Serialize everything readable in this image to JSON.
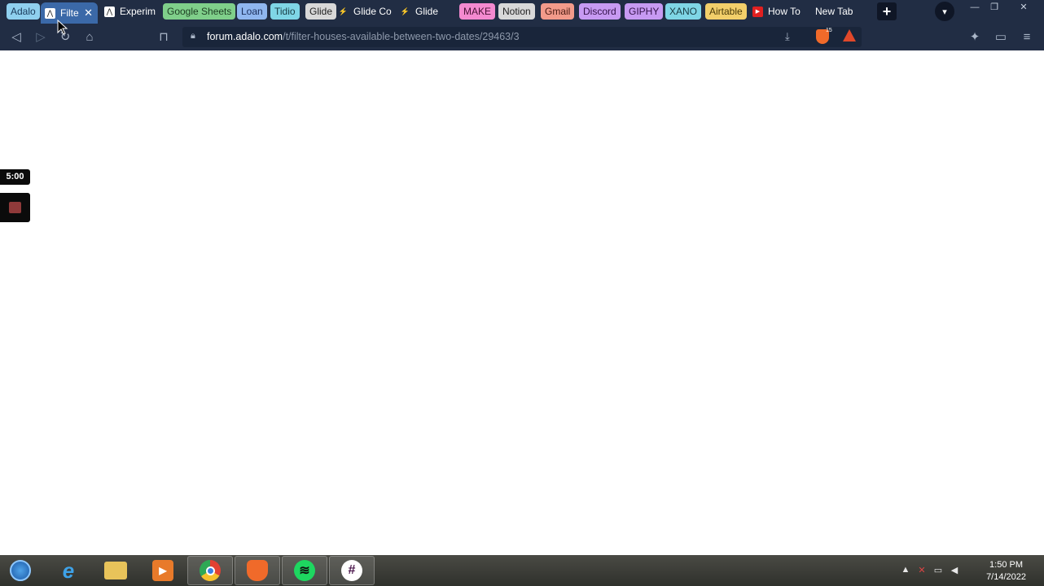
{
  "browser": {
    "tabs": [
      {
        "label": "Adalo",
        "type": "group",
        "color": "#8fd0ef",
        "text_color": "#1a3a5a"
      },
      {
        "label": "Filte",
        "type": "tab",
        "active": true,
        "icon": "adalo-icon"
      },
      {
        "label": "Experim",
        "type": "tab",
        "icon": "adalo-icon"
      },
      {
        "label": "Google Sheets",
        "type": "group",
        "color": "#7fcf8a",
        "text_color": "#1d3d22"
      },
      {
        "label": "Loan",
        "type": "group",
        "color": "#8fb6ef",
        "text_color": "#1a2d5a"
      },
      {
        "label": "Tidio",
        "type": "group",
        "color": "#7fd6e6",
        "text_color": "#1a3d45"
      },
      {
        "label": "Glide",
        "type": "group",
        "color": "#d8d8d8",
        "text_color": "#222222"
      },
      {
        "label": "Glide Co",
        "type": "tab",
        "icon": "glide-icon"
      },
      {
        "label": "Glide",
        "type": "tab",
        "icon": "glide-icon"
      },
      {
        "label": "MAKE",
        "type": "group",
        "color": "#f48ad0",
        "text_color": "#4a1236"
      },
      {
        "label": "Notion",
        "type": "group",
        "color": "#d8d8d8",
        "text_color": "#222222"
      },
      {
        "label": "Gmail",
        "type": "group",
        "color": "#f29a8a",
        "text_color": "#4a1a12"
      },
      {
        "label": "Discord",
        "type": "group",
        "color": "#c79af2",
        "text_color": "#34124a"
      },
      {
        "label": "GIPHY",
        "type": "group",
        "color": "#c79af2",
        "text_color": "#34124a"
      },
      {
        "label": "XANO",
        "type": "group",
        "color": "#7fd6e6",
        "text_color": "#1a3d45"
      },
      {
        "label": "Airtable",
        "type": "group",
        "color": "#f2cf6a",
        "text_color": "#4a3a08"
      },
      {
        "label": "How To",
        "type": "tab",
        "icon": "youtube-icon"
      },
      {
        "label": "New Tab",
        "type": "tab",
        "icon": ""
      }
    ],
    "url_host": "forum.adalo.com",
    "url_path": "/t/filter-houses-available-between-two-dates/29463/3",
    "brave_badge": "15"
  },
  "recorder": {
    "timer": "5:00"
  },
  "taskbar": {
    "apps": [
      {
        "name": "start-button"
      },
      {
        "name": "internet-explorer"
      },
      {
        "name": "file-explorer"
      },
      {
        "name": "media-player"
      },
      {
        "name": "chrome"
      },
      {
        "name": "brave"
      },
      {
        "name": "spotify"
      },
      {
        "name": "slack"
      }
    ],
    "time": "1:50 PM",
    "date": "7/14/2022"
  }
}
